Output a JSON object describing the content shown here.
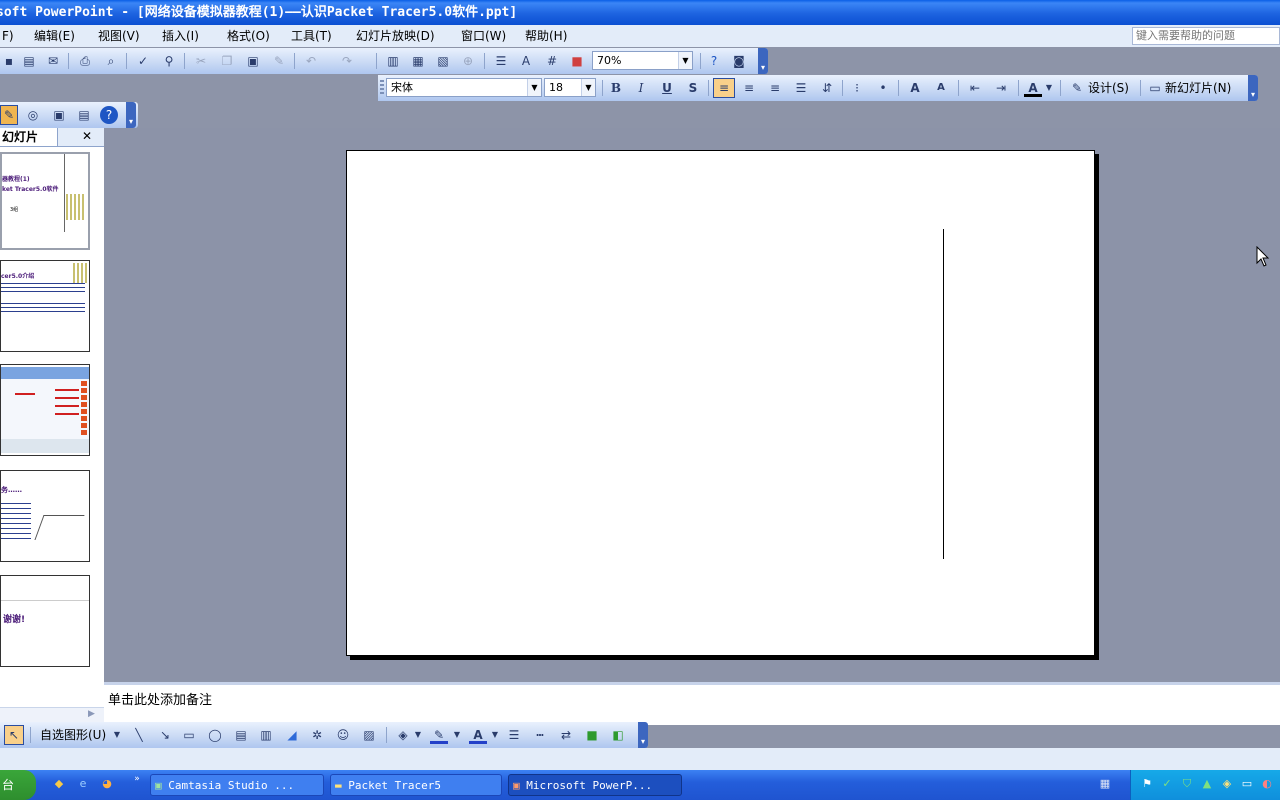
{
  "window": {
    "title": "soft PowerPoint - [网络设备模拟器教程(1)——认识Packet Tracer5.0软件.ppt]"
  },
  "menu": {
    "items": [
      "F)",
      "编辑(E)",
      "视图(V)",
      "插入(I)",
      "格式(O)",
      "工具(T)",
      "幻灯片放映(D)",
      "窗口(W)",
      "帮助(H)"
    ],
    "help_placeholder": "键入需要帮助的问题"
  },
  "toolbar_standard": {
    "zoom_value": "70%"
  },
  "toolbar_format": {
    "font_name": "宋体",
    "font_size": "18",
    "bold_label": "B",
    "italic_label": "I",
    "underline_label": "U",
    "shadow_label": "S",
    "design_label": "设计(S)",
    "new_slide_label": "新幻灯片(N)"
  },
  "slides_pane": {
    "tab_label": "幻灯片",
    "close_glyph": "✕",
    "thumbnails": [
      {
        "line1": "器教程(1)",
        "line2": "ket Tracer5.0软件",
        "line3": "3组"
      },
      {
        "line1": "cer5.0介绍"
      },
      {},
      {
        "line1": "务……"
      },
      {
        "line1": "谢谢!"
      }
    ]
  },
  "notes": {
    "placeholder": "单击此处添加备注"
  },
  "drawing_toolbar": {
    "autoshapes_label": "自选图形(U)"
  },
  "taskbar": {
    "start_label": "台",
    "buttons": [
      "Camtasia Studio ...",
      "Packet Tracer5",
      "Microsoft PowerP..."
    ]
  },
  "colors": {
    "title_bar": "#1d63e0",
    "menu_bg": "#e3ecf9",
    "workspace": "#8c93a8",
    "taskbar": "#245edb"
  }
}
